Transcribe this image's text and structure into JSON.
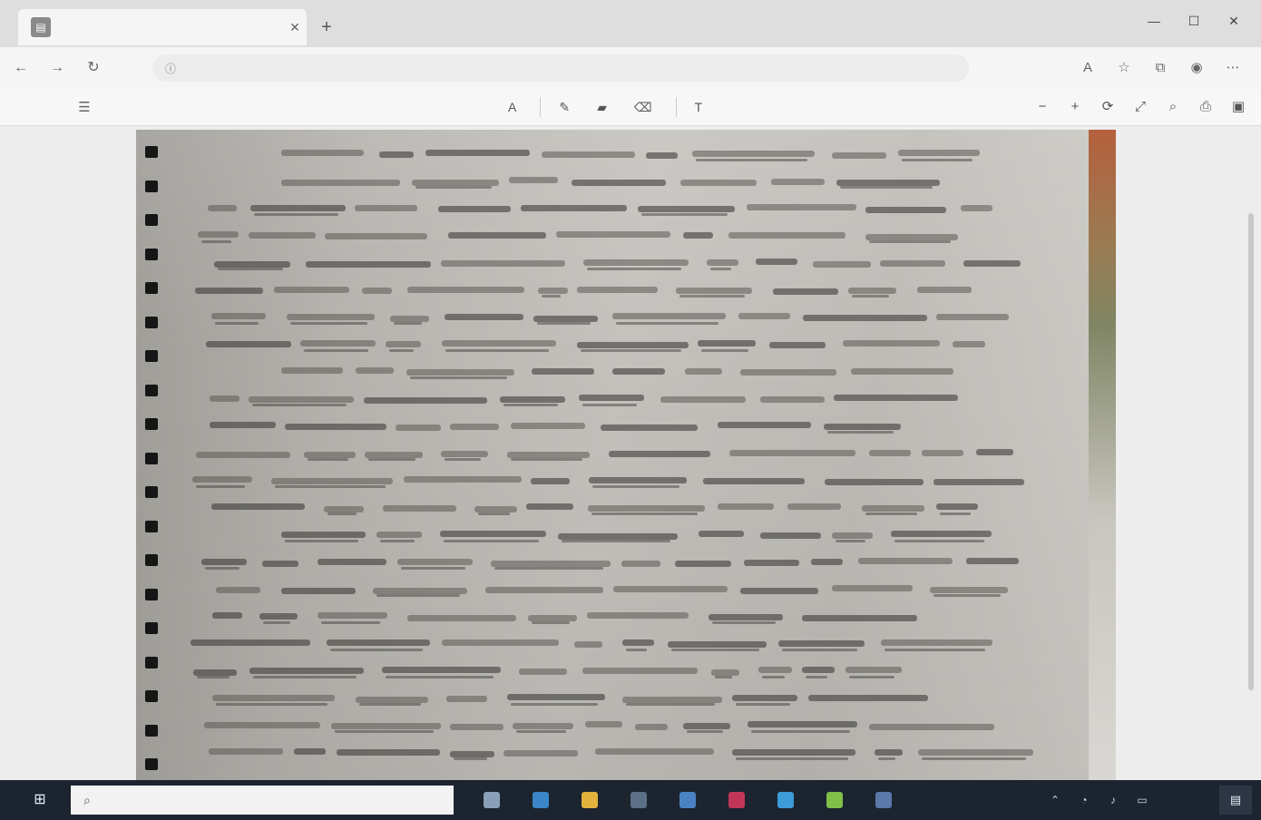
{
  "browser": {
    "tab": {
      "favicon_icon": "pdf-document-icon",
      "title": "",
      "close_glyph": "✕"
    },
    "new_tab_glyph": "+",
    "window_controls": [
      "—",
      "☐",
      "✕"
    ],
    "address": {
      "url": ""
    }
  },
  "pdf_toolbar": {
    "page_info": "",
    "tools": [
      {
        "icon": "read-aloud-icon",
        "label": ""
      },
      {
        "icon": "draw-icon",
        "label": ""
      },
      {
        "icon": "highlight-icon",
        "label": ""
      },
      {
        "icon": "erase-icon",
        "label": ""
      },
      {
        "icon": "text-icon",
        "label": ""
      }
    ]
  },
  "document": {
    "content": "photographed handwritten notebook page"
  },
  "taskbar": {
    "search": {
      "placeholder": "",
      "value": ""
    },
    "apps": [
      {
        "icon": "task-view-icon",
        "color": "#8aa0b8"
      },
      {
        "icon": "edge-browser-icon",
        "color": "#3a86c8"
      },
      {
        "icon": "file-explorer-icon",
        "color": "#e3b23c"
      },
      {
        "icon": "store-icon",
        "color": "#5b6f86"
      },
      {
        "icon": "mail-icon",
        "color": "#4b82c4"
      },
      {
        "icon": "media-icon",
        "color": "#c2365a"
      },
      {
        "icon": "chrome-icon",
        "color": "#3d9bd8"
      },
      {
        "icon": "app-icon-green",
        "color": "#7fbf4a"
      },
      {
        "icon": "app-icon-blue",
        "color": "#5a78a8"
      }
    ],
    "clock": {
      "time": "",
      "date": ""
    }
  }
}
